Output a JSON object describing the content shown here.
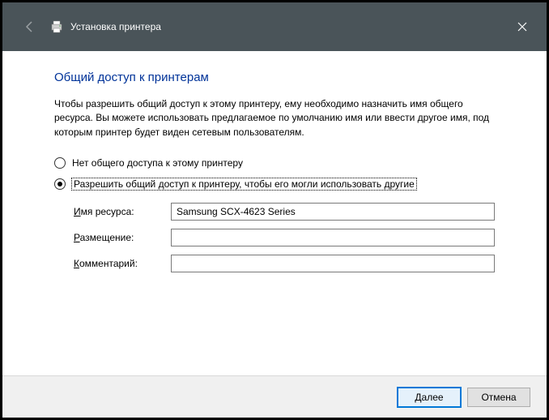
{
  "titlebar": {
    "title": "Установка принтера"
  },
  "content": {
    "heading": "Общий доступ к принтерам",
    "description": "Чтобы разрешить общий доступ к этому принтеру, ему необходимо назначить имя общего ресурса. Вы можете использовать предлагаемое по умолчанию имя или ввести другое имя, под которым принтер будет виден сетевым пользователям.",
    "radio_no_share": "Нет общего доступа к этому принтеру",
    "radio_share": "Разрешить общий доступ к принтеру, чтобы его могли использовать другие",
    "form": {
      "resource_prefix": "И",
      "resource_rest": "мя ресурса:",
      "resource_value": "Samsung SCX-4623 Series",
      "location_prefix": "Р",
      "location_rest": "азмещение:",
      "location_value": "",
      "comment_prefix": "К",
      "comment_rest": "омментарий:",
      "comment_value": ""
    }
  },
  "footer": {
    "next_prefix": "Д",
    "next_rest": "алее",
    "cancel": "Отмена"
  }
}
